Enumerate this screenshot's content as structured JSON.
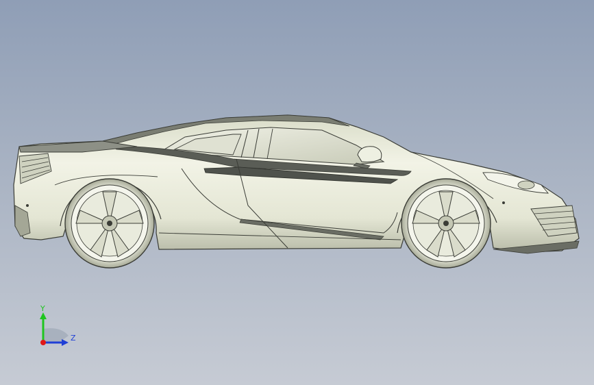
{
  "view": {
    "background_top": "#8f9eb6",
    "background_bottom": "#c6cbd4"
  },
  "triad": {
    "y_label": "Y",
    "z_label": "Z",
    "y_color": "#1fc51f",
    "z_color": "#1f3fd6",
    "x_color": "#e01818"
  },
  "model": {
    "body_color": "#e6e8d8",
    "shade_color": "#c9ccb8",
    "line_color": "#3a3c36",
    "dark_color": "#505450"
  }
}
